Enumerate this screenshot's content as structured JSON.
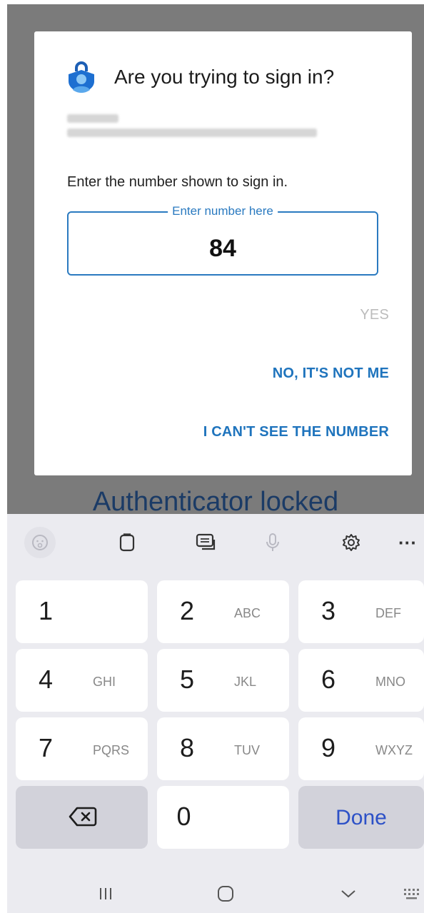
{
  "dialog": {
    "title": "Are you trying to sign in?",
    "instruction": "Enter the number shown to sign in.",
    "field_label": "Enter number here",
    "field_value": "84",
    "yes_label": "YES",
    "no_label": "NO, IT'S NOT ME",
    "cant_see_label": "I CAN'T SEE THE NUMBER"
  },
  "background": {
    "locked_text": "Authenticator locked"
  },
  "keyboard": {
    "toolbar": [
      "sticker-icon",
      "clipboard-icon",
      "keyboard-mode-icon",
      "microphone-icon",
      "settings-icon",
      "more-icon"
    ],
    "more_label": "···",
    "keys": [
      {
        "num": "1",
        "sub": ""
      },
      {
        "num": "2",
        "sub": "ABC"
      },
      {
        "num": "3",
        "sub": "DEF"
      },
      {
        "num": "4",
        "sub": "GHI"
      },
      {
        "num": "5",
        "sub": "JKL"
      },
      {
        "num": "6",
        "sub": "MNO"
      },
      {
        "num": "7",
        "sub": "PQRS"
      },
      {
        "num": "8",
        "sub": "TUV"
      },
      {
        "num": "9",
        "sub": "WXYZ"
      }
    ],
    "zero": "0",
    "done_label": "Done"
  },
  "navbar": [
    "recent-apps-icon",
    "home-icon",
    "back-icon",
    "keyboard-grid-icon"
  ],
  "colors": {
    "accent": "#1f74bd",
    "done": "#2d51c7",
    "overlay": "#7b7b7b"
  }
}
